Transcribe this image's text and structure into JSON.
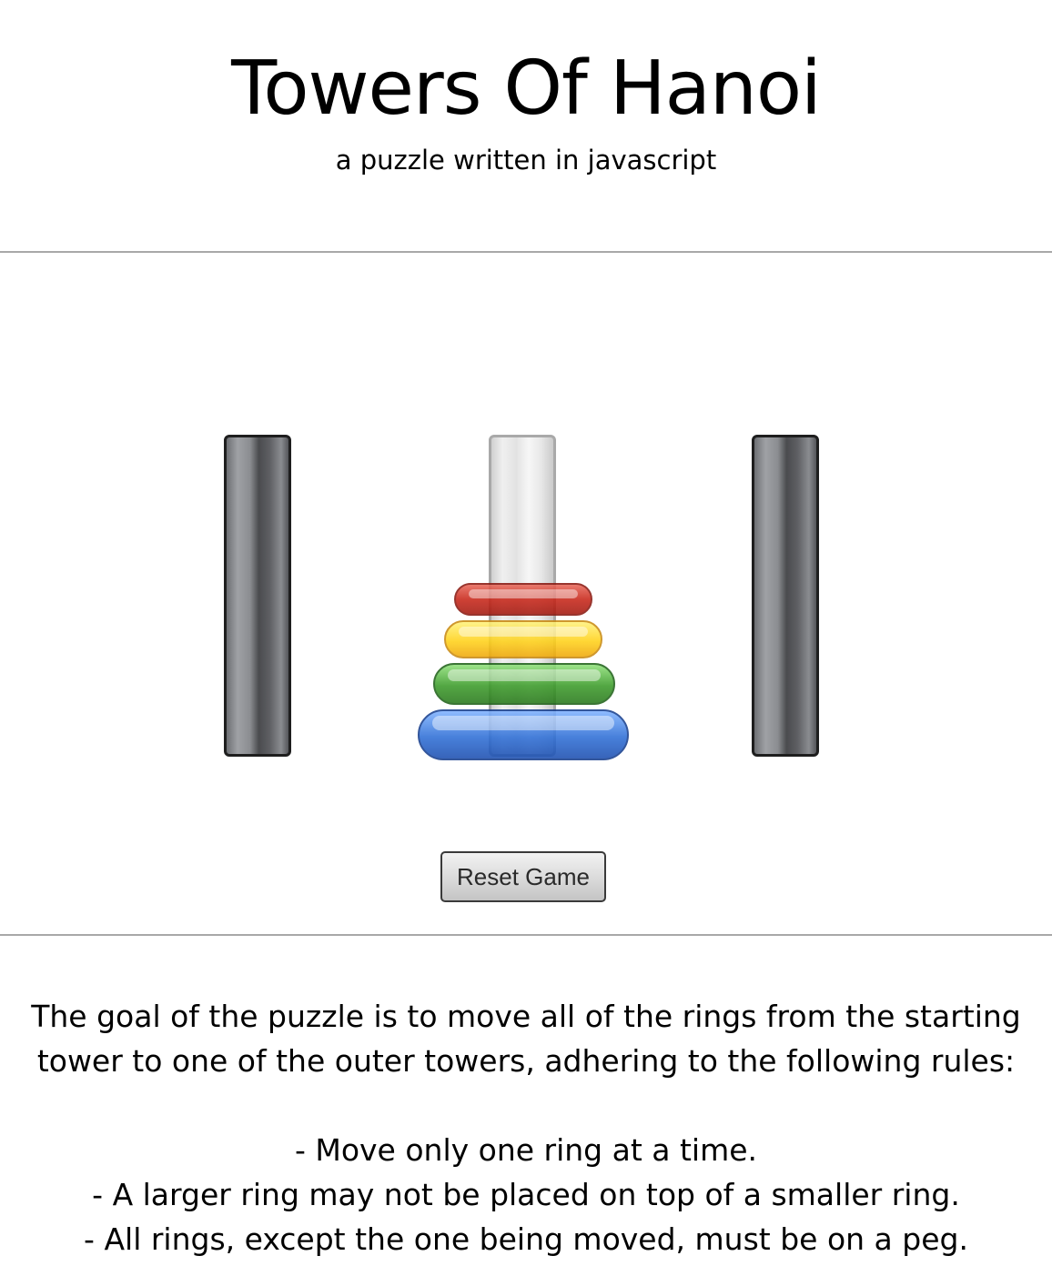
{
  "header": {
    "title": "Towers Of Hanoi",
    "subtitle": "a puzzle written in javascript"
  },
  "game": {
    "pegs": [
      {
        "name": "left",
        "rings": []
      },
      {
        "name": "center",
        "rings": [
          "blue",
          "green",
          "yellow",
          "red"
        ]
      },
      {
        "name": "right",
        "rings": []
      }
    ],
    "ring_colors": {
      "red": "#c8271a",
      "yellow": "#ffd21a",
      "green": "#3c9b2a",
      "blue": "#2f6fd6"
    },
    "reset_label": "Reset Game"
  },
  "instructions": {
    "intro_line1": "The goal of the puzzle is to move all of the rings from the starting",
    "intro_line2": "tower to one of the outer towers, adhering to the following rules:",
    "rules": [
      "- Move only one ring at a time.",
      "- A larger ring may not be placed on top of a smaller ring.",
      "- All rings, except the one being moved, must be on a peg."
    ]
  }
}
